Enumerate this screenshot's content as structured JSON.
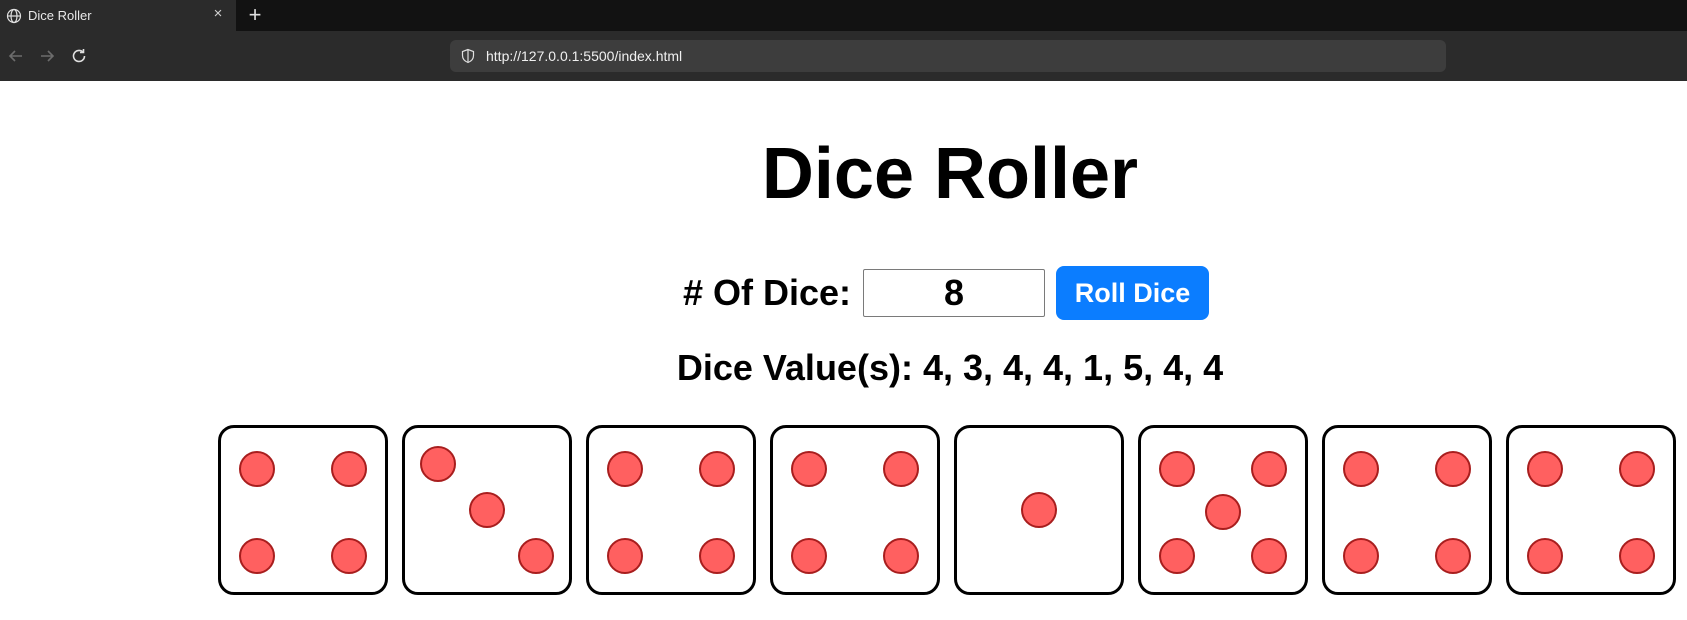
{
  "browser": {
    "tab_title": "Dice Roller",
    "tab_close": "×",
    "new_tab": "+",
    "url": "http://127.0.0.1:5500/index.html"
  },
  "page": {
    "title": "Dice Roller",
    "dice_count_label": "# Of Dice:",
    "dice_count_value": "8",
    "roll_button": "Roll Dice",
    "values_label": "Dice Value(s):",
    "values_text": "4, 3, 4, 4, 1, 5, 4, 4"
  },
  "dice": [
    4,
    3,
    4,
    4,
    1,
    5,
    4,
    4
  ],
  "colors": {
    "pip_fill": "#ff6060",
    "pip_stroke": "#a81e1e",
    "button": "#0b7dff"
  }
}
